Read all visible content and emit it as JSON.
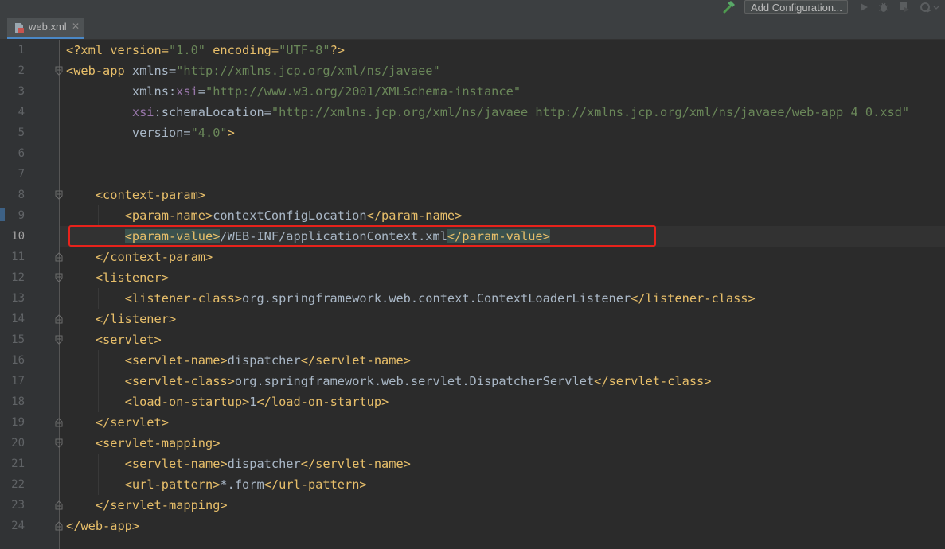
{
  "toolbar": {
    "run_config_label": "Add Configuration...",
    "icons": [
      "hammer-icon",
      "run-icon",
      "debug-icon",
      "coverage-icon",
      "profile-icon"
    ]
  },
  "tabs": [
    {
      "label": "web.xml",
      "icon": "xml-file-icon",
      "active": true
    }
  ],
  "editor": {
    "current_line": "10",
    "highlighted_line": "10",
    "line_numbers": [
      "1",
      "2",
      "3",
      "4",
      "5",
      "6",
      "7",
      "8",
      "9",
      "10",
      "11",
      "12",
      "13",
      "14",
      "15",
      "16",
      "17",
      "18",
      "19",
      "20",
      "21",
      "22",
      "23",
      "24"
    ],
    "lines": [
      {
        "n": "1",
        "segments": [
          "<?xml version=",
          "\"1.0\"",
          " encoding=",
          "\"UTF-8\"",
          "?>"
        ]
      },
      {
        "n": "2",
        "segments": [
          "<web-app",
          " xmlns=",
          "\"http://xmlns.jcp.org/xml/ns/javaee\""
        ]
      },
      {
        "n": "3",
        "segments": [
          "xmlns:",
          "xsi",
          "=",
          "\"http://www.w3.org/2001/XMLSchema-instance\""
        ]
      },
      {
        "n": "4",
        "segments": [
          "xsi",
          ":schemaLocation=",
          "\"http://xmlns.jcp.org/xml/ns/javaee http://xmlns.jcp.org/xml/ns/javaee/web-app_4_0.xsd\""
        ]
      },
      {
        "n": "5",
        "segments": [
          "version=",
          "\"4.0\"",
          ">"
        ]
      },
      {
        "n": "6",
        "segments": []
      },
      {
        "n": "7",
        "segments": []
      },
      {
        "n": "8",
        "segments": [
          "<context-param>"
        ]
      },
      {
        "n": "9",
        "segments": [
          "<param-name>",
          "contextConfigLocation",
          "</param-name>"
        ]
      },
      {
        "n": "10",
        "segments": [
          "<param-value>",
          "/WEB-INF/applicationContext.xml",
          "</param-value>"
        ]
      },
      {
        "n": "11",
        "segments": [
          "</context-param>"
        ]
      },
      {
        "n": "12",
        "segments": [
          "<listener>"
        ]
      },
      {
        "n": "13",
        "segments": [
          "<listener-class>",
          "org.springframework.web.context.ContextLoaderListener",
          "</listener-class>"
        ]
      },
      {
        "n": "14",
        "segments": [
          "</listener>"
        ]
      },
      {
        "n": "15",
        "segments": [
          "<servlet>"
        ]
      },
      {
        "n": "16",
        "segments": [
          "<servlet-name>",
          "dispatcher",
          "</servlet-name>"
        ]
      },
      {
        "n": "17",
        "segments": [
          "<servlet-class>",
          "org.springframework.web.servlet.DispatcherServlet",
          "</servlet-class>"
        ]
      },
      {
        "n": "18",
        "segments": [
          "<load-on-startup>",
          "1",
          "</load-on-startup>"
        ]
      },
      {
        "n": "19",
        "segments": [
          "</servlet>"
        ]
      },
      {
        "n": "20",
        "segments": [
          "<servlet-mapping>"
        ]
      },
      {
        "n": "21",
        "segments": [
          "<servlet-name>",
          "dispatcher",
          "</servlet-name>"
        ]
      },
      {
        "n": "22",
        "segments": [
          "<url-pattern>",
          "*.form",
          "</url-pattern>"
        ]
      },
      {
        "n": "23",
        "segments": [
          "</servlet-mapping>"
        ]
      },
      {
        "n": "24",
        "segments": [
          "</web-app>"
        ]
      }
    ]
  },
  "colors": {
    "background": "#2b2b2b",
    "gutter": "#313335",
    "tag": "#e8bf6a",
    "attribute_value": "#6a8759",
    "namespace_prefix": "#9876aa",
    "text": "#a9b7c6",
    "line_number": "#606366",
    "annotation_box": "#e8221b"
  }
}
